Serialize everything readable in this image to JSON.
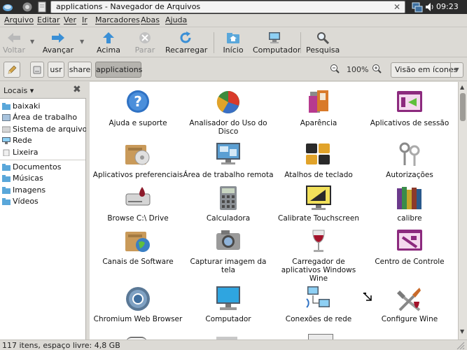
{
  "window": {
    "title": "applications - Navegador de Arquivos",
    "close": "✕",
    "clock": "09:23"
  },
  "menubar": [
    "Arquivo",
    "Editar",
    "Ver",
    "Ir",
    "Marcadores",
    "Abas",
    "Ajuda"
  ],
  "toolbar": {
    "back": "Voltar",
    "forward": "Avançar",
    "up": "Acima",
    "stop": "Parar",
    "reload": "Recarregar",
    "home": "Início",
    "computer": "Computador",
    "search": "Pesquisa"
  },
  "location": {
    "path": [
      "usr",
      "share",
      "applications"
    ],
    "zoom": "100%",
    "view": "Visão em ícones"
  },
  "sidebar": {
    "header": "Locais ▾",
    "close": "✖",
    "places": [
      "baixaki",
      "Área de trabalho",
      "Sistema de arquivos",
      "Rede",
      "Lixeira"
    ],
    "bookmarks": [
      "Documentos",
      "Músicas",
      "Imagens",
      "Vídeos"
    ]
  },
  "items": [
    {
      "label": "Ajuda e suporte",
      "icon": "help-icon"
    },
    {
      "label": "Analisador do Uso do Disco",
      "icon": "disk-usage-icon"
    },
    {
      "label": "Aparência",
      "icon": "appearance-icon"
    },
    {
      "label": "Aplicativos de sessão",
      "icon": "session-apps-icon"
    },
    {
      "label": "Aplicativos preferenciais",
      "icon": "preferred-apps-icon"
    },
    {
      "label": "Área de trabalho remota",
      "icon": "remote-desktop-icon"
    },
    {
      "label": "Atalhos de teclado",
      "icon": "keyboard-shortcuts-icon"
    },
    {
      "label": "Autorizações",
      "icon": "authorizations-icon"
    },
    {
      "label": "Browse C:\\ Drive",
      "icon": "drive-icon"
    },
    {
      "label": "Calculadora",
      "icon": "calculator-icon"
    },
    {
      "label": "Calibrate Touchscreen",
      "icon": "touchscreen-icon"
    },
    {
      "label": "calibre",
      "icon": "calibre-icon"
    },
    {
      "label": "Canais de Software",
      "icon": "software-channels-icon"
    },
    {
      "label": "Capturar imagem da tela",
      "icon": "screenshot-icon"
    },
    {
      "label": "Carregador de aplicativos Windows Wine",
      "icon": "wine-loader-icon"
    },
    {
      "label": "Centro de Controle",
      "icon": "control-center-icon"
    },
    {
      "label": "Chromium Web Browser",
      "icon": "chromium-icon"
    },
    {
      "label": "Computador",
      "icon": "computer-icon"
    },
    {
      "label": "Conexões de rede",
      "icon": "network-connections-icon"
    },
    {
      "label": "Configure Wine",
      "icon": "configure-wine-icon"
    }
  ],
  "status": "117 itens, espaço livre: 4,8 GB"
}
